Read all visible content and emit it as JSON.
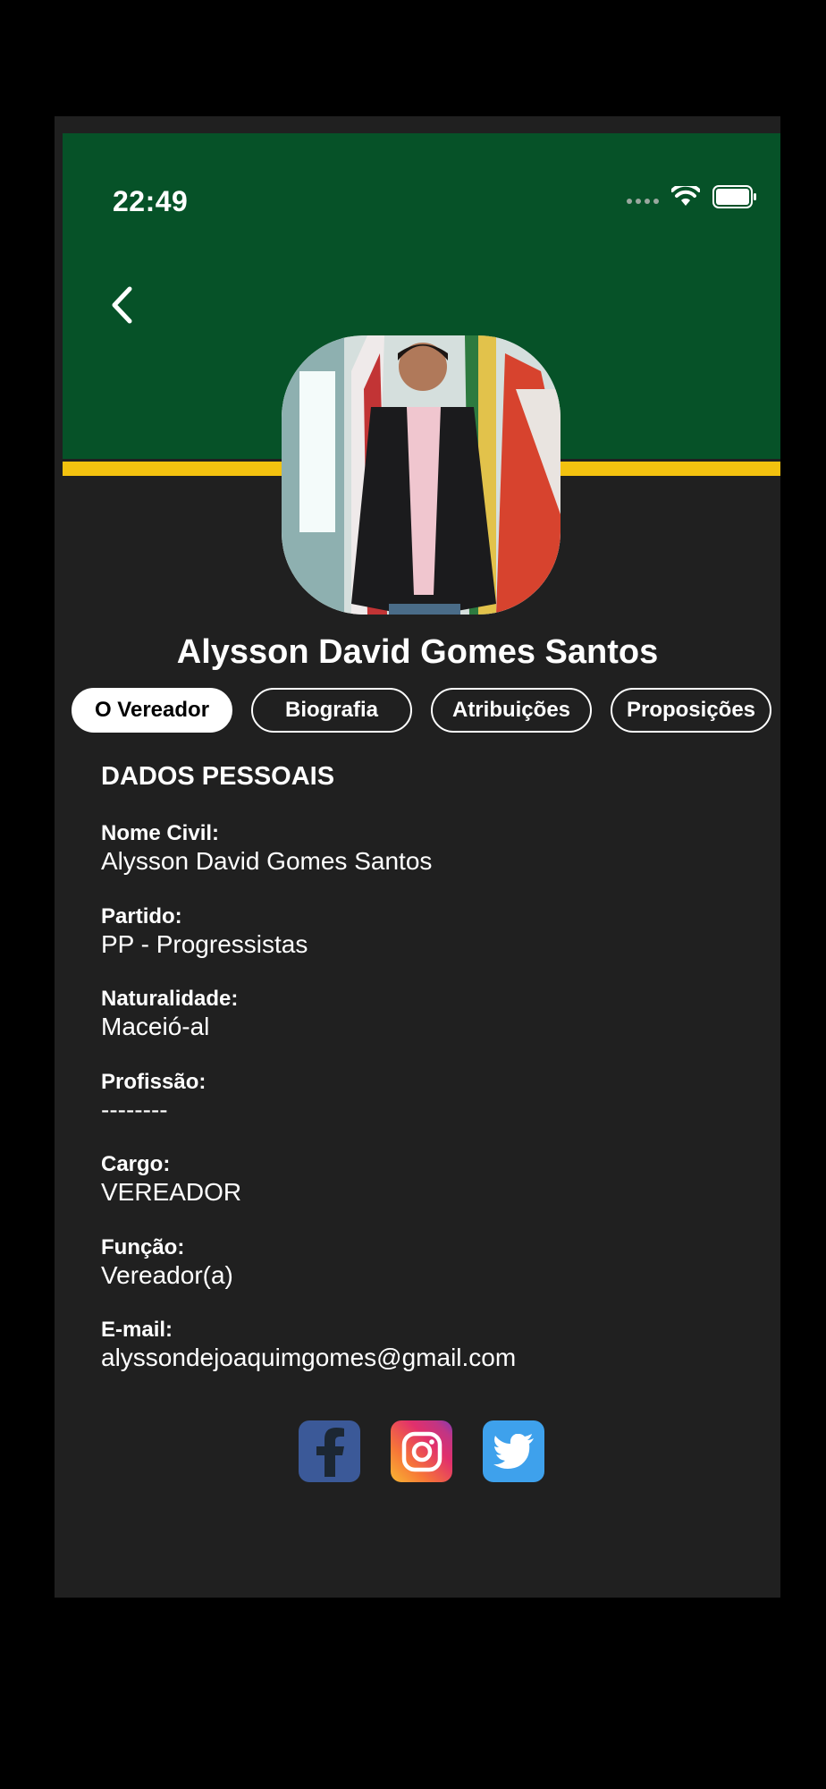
{
  "status_bar": {
    "time": "22:49"
  },
  "header": {
    "back_label": "Back"
  },
  "profile": {
    "name": "Alysson David Gomes Santos"
  },
  "tabs": [
    {
      "label": "O Vereador",
      "active": true
    },
    {
      "label": "Biografia",
      "active": false
    },
    {
      "label": "Atribuições",
      "active": false
    },
    {
      "label": "Proposições",
      "active": false
    }
  ],
  "section": {
    "title": "DADOS PESSOAIS"
  },
  "fields": [
    {
      "label": "Nome Civil:",
      "value": "Alysson David Gomes Santos"
    },
    {
      "label": "Partido:",
      "value": "PP - Progressistas"
    },
    {
      "label": "Naturalidade:",
      "value": "Maceió-al"
    },
    {
      "label": "Profissão:",
      "value": "--------"
    },
    {
      "label": "Cargo:",
      "value": "VEREADOR"
    },
    {
      "label": "Função:",
      "value": "Vereador(a)"
    },
    {
      "label": "E-mail:",
      "value": "alyssondejoaquimgomes@gmail.com"
    }
  ],
  "socials": [
    {
      "icon": "facebook-icon",
      "color": "#3b5998"
    },
    {
      "icon": "instagram-icon",
      "color": "#e1306c"
    },
    {
      "icon": "twitter-icon",
      "color": "#3ea1ec"
    }
  ],
  "colors": {
    "header_green": "#065228",
    "accent_yellow": "#f3c20f",
    "background": "#202020"
  }
}
